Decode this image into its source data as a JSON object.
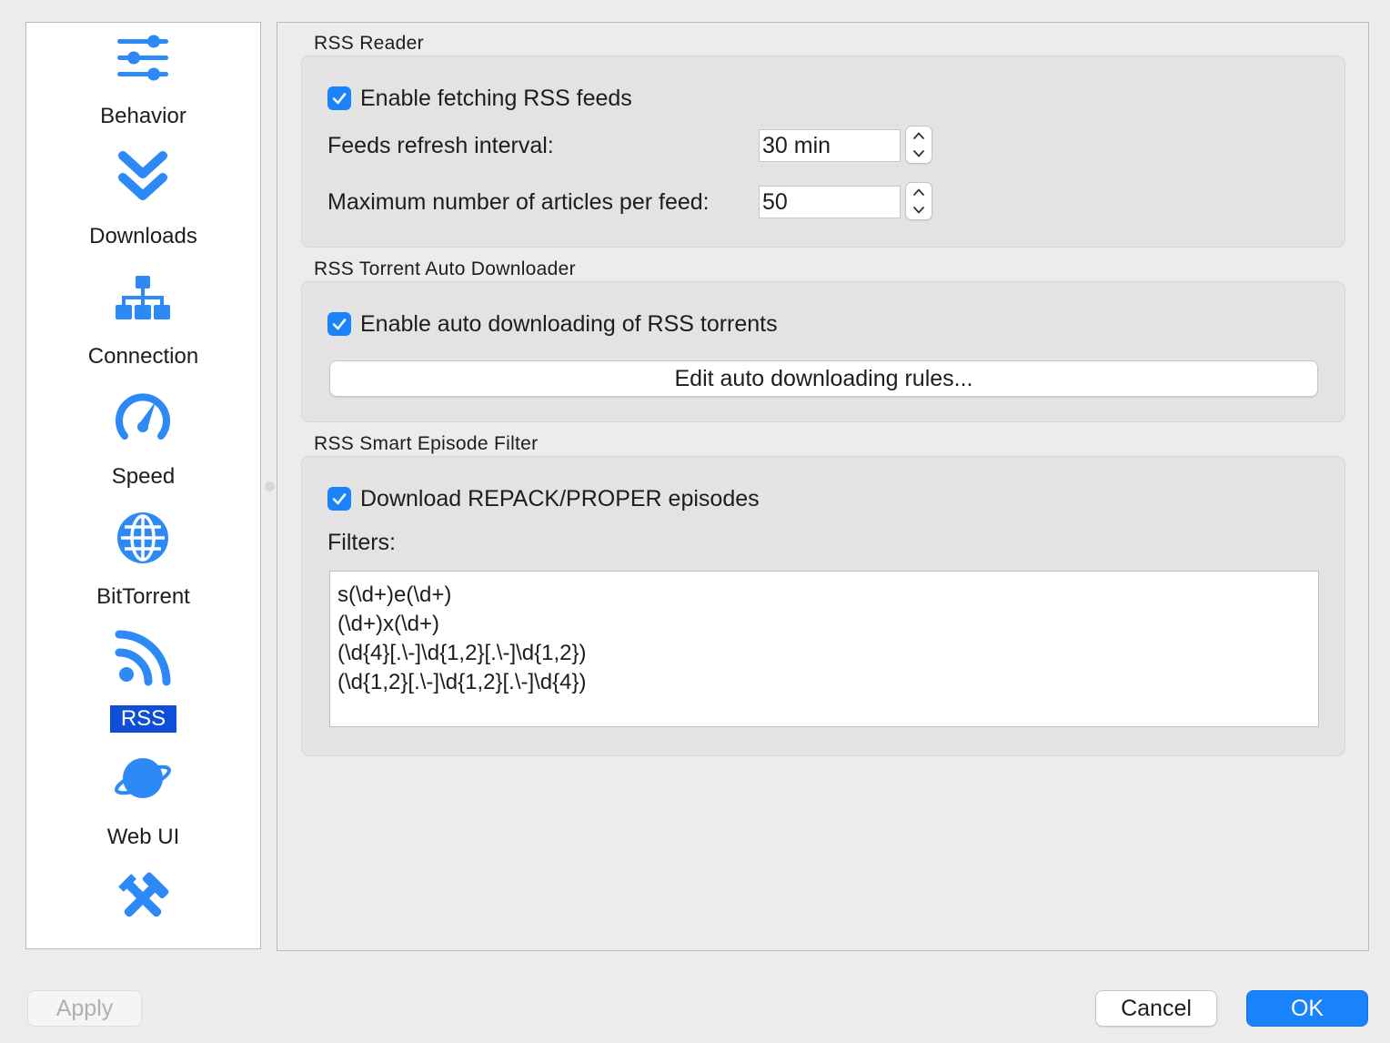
{
  "colors": {
    "accent": "#1a82fb",
    "selection": "#0f4fd8",
    "icon": "#2d89f6"
  },
  "sidebar": {
    "items": [
      {
        "label": "Behavior",
        "icon": "sliders-icon"
      },
      {
        "label": "Downloads",
        "icon": "double-chevron-down-icon"
      },
      {
        "label": "Connection",
        "icon": "network-tree-icon"
      },
      {
        "label": "Speed",
        "icon": "speedometer-icon"
      },
      {
        "label": "BitTorrent",
        "icon": "globe-icon"
      },
      {
        "label": "RSS",
        "icon": "rss-icon",
        "selected": true
      },
      {
        "label": "Web UI",
        "icon": "planet-icon"
      },
      {
        "label": "",
        "icon": "tools-icon"
      }
    ]
  },
  "rss_reader": {
    "title": "RSS Reader",
    "enable_label": "Enable fetching RSS feeds",
    "enable_checked": true,
    "refresh_label": "Feeds refresh interval:",
    "refresh_value": "30 min",
    "max_articles_label": "Maximum number of articles per feed:",
    "max_articles_value": "50"
  },
  "auto_downloader": {
    "title": "RSS Torrent Auto Downloader",
    "enable_label": "Enable auto downloading of RSS torrents",
    "enable_checked": true,
    "edit_rules_label": "Edit auto downloading rules..."
  },
  "smart_filter": {
    "title": "RSS Smart Episode Filter",
    "repack_label": "Download REPACK/PROPER episodes",
    "repack_checked": true,
    "filters_label": "Filters:",
    "filters": [
      "s(\\d+)e(\\d+)",
      "(\\d+)x(\\d+)",
      "(\\d{4}[.\\-]\\d{1,2}[.\\-]\\d{1,2})",
      "(\\d{1,2}[.\\-]\\d{1,2}[.\\-]\\d{4})"
    ]
  },
  "footer": {
    "apply_label": "Apply",
    "cancel_label": "Cancel",
    "ok_label": "OK"
  }
}
